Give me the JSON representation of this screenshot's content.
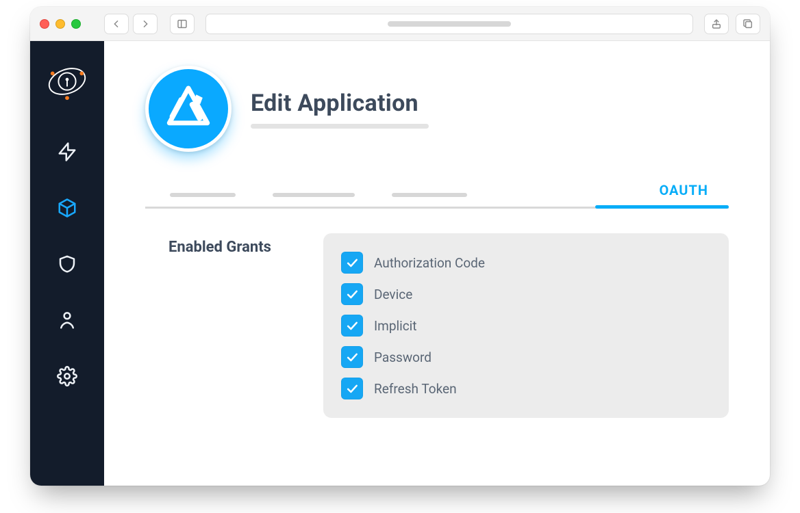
{
  "page": {
    "title": "Edit Application",
    "tabs": {
      "active_label": "OAUTH",
      "ghost_count": 3
    },
    "section_label": "Enabled Grants",
    "grants": [
      {
        "label": "Authorization Code",
        "checked": true
      },
      {
        "label": "Device",
        "checked": true
      },
      {
        "label": "Implicit",
        "checked": true
      },
      {
        "label": "Password",
        "checked": true
      },
      {
        "label": "Refresh Token",
        "checked": true
      }
    ]
  },
  "sidebar": {
    "items": [
      {
        "name": "home",
        "active": false
      },
      {
        "name": "activity",
        "active": false
      },
      {
        "name": "applications",
        "active": true
      },
      {
        "name": "security",
        "active": false
      },
      {
        "name": "users",
        "active": false
      },
      {
        "name": "settings",
        "active": false
      }
    ]
  },
  "colors": {
    "accent": "#07adf8",
    "dark": "#131c2b",
    "text": "#3d4a5c"
  }
}
